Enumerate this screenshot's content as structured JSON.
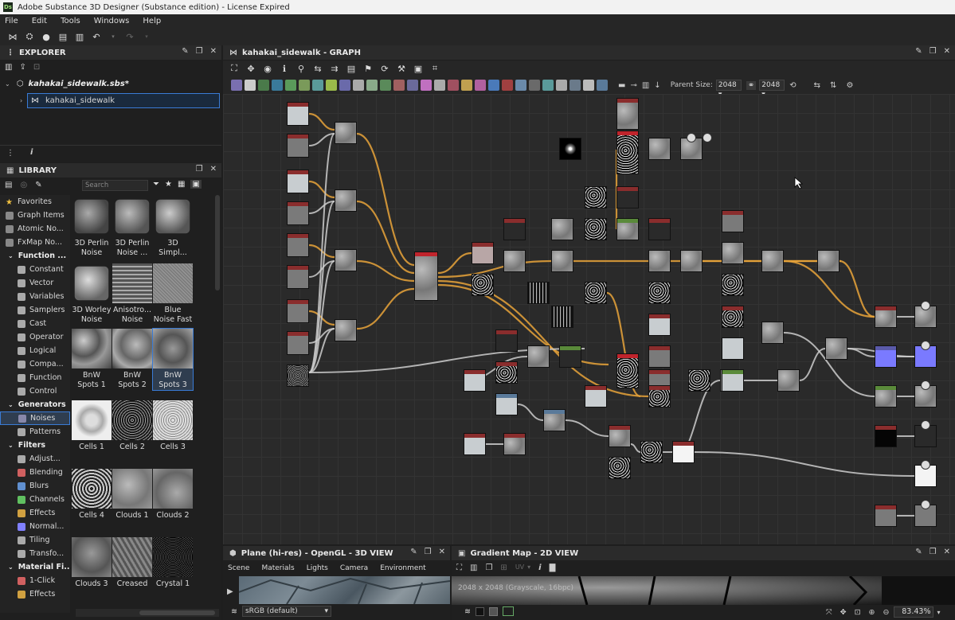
{
  "app": {
    "window_title": "Adobe Substance 3D Designer (Substance edition) - License Expired",
    "app_icon_label": "Ds"
  },
  "menu": [
    "File",
    "Edit",
    "Tools",
    "Windows",
    "Help"
  ],
  "explorer": {
    "title": "EXPLORER",
    "package": "kahakai_sidewalk.sbs*",
    "graph": "kahakai_sidewalk"
  },
  "library": {
    "title": "LIBRARY",
    "search_placeholder": "Search",
    "sidebar": [
      {
        "label": "Favorites",
        "color": "#f0c040",
        "cat": false
      },
      {
        "label": "Graph Items",
        "color": "#888888",
        "cat": false
      },
      {
        "label": "Atomic No...",
        "color": "#888888",
        "cat": false
      },
      {
        "label": "FxMap No...",
        "color": "#888888",
        "cat": false
      },
      {
        "label": "Function ...",
        "color": "",
        "cat": true
      },
      {
        "label": "Constant",
        "color": "#aaaaaa",
        "cat": false
      },
      {
        "label": "Vector",
        "color": "#aaaaaa",
        "cat": false
      },
      {
        "label": "Variables",
        "color": "#aaaaaa",
        "cat": false
      },
      {
        "label": "Samplers",
        "color": "#aaaaaa",
        "cat": false
      },
      {
        "label": "Cast",
        "color": "#aaaaaa",
        "cat": false
      },
      {
        "label": "Operator",
        "color": "#aaaaaa",
        "cat": false
      },
      {
        "label": "Logical",
        "color": "#aaaaaa",
        "cat": false
      },
      {
        "label": "Compa...",
        "color": "#aaaaaa",
        "cat": false
      },
      {
        "label": "Function",
        "color": "#aaaaaa",
        "cat": false
      },
      {
        "label": "Control",
        "color": "#aaaaaa",
        "cat": false
      },
      {
        "label": "Generators",
        "color": "",
        "cat": true
      },
      {
        "label": "Noises",
        "color": "#8888aa",
        "cat": false
      },
      {
        "label": "Patterns",
        "color": "#aaaaaa",
        "cat": false
      },
      {
        "label": "Filters",
        "color": "",
        "cat": true
      },
      {
        "label": "Adjust...",
        "color": "#aaaaaa",
        "cat": false
      },
      {
        "label": "Blending",
        "color": "#d06060",
        "cat": false
      },
      {
        "label": "Blurs",
        "color": "#6090d0",
        "cat": false
      },
      {
        "label": "Channels",
        "color": "#60c060",
        "cat": false
      },
      {
        "label": "Effects",
        "color": "#d0a040",
        "cat": false
      },
      {
        "label": "Normal...",
        "color": "#8080ff",
        "cat": false
      },
      {
        "label": "Tiling",
        "color": "#aaaaaa",
        "cat": false
      },
      {
        "label": "Transfo...",
        "color": "#aaaaaa",
        "cat": false
      },
      {
        "label": "Material Fi...",
        "color": "",
        "cat": true
      },
      {
        "label": "1-Click",
        "color": "#d06060",
        "cat": false
      },
      {
        "label": "Effects",
        "color": "#d0a040",
        "cat": false
      }
    ],
    "thumbs": [
      {
        "label": "3D Perlin Noise"
      },
      {
        "label": "3D Perlin Noise ..."
      },
      {
        "label": "3D Simpl..."
      },
      {
        "label": "3D Worley Noise"
      },
      {
        "label": "Anisotro... Noise"
      },
      {
        "label": "Blue Noise Fast"
      },
      {
        "label": "BnW Spots 1"
      },
      {
        "label": "BnW Spots 2"
      },
      {
        "label": "BnW Spots 3"
      },
      {
        "label": "Cells 1"
      },
      {
        "label": "Cells 2"
      },
      {
        "label": "Cells 3"
      },
      {
        "label": "Cells 4"
      },
      {
        "label": "Clouds 1"
      },
      {
        "label": "Clouds 2"
      },
      {
        "label": "Clouds 3"
      },
      {
        "label": "Creased"
      },
      {
        "label": "Crystal 1"
      }
    ]
  },
  "graph": {
    "title": "kahakai_sidewalk - GRAPH",
    "parent_size_label": "Parent Size:",
    "width_value": "2048",
    "height_value": "2048"
  },
  "view3d": {
    "title": "Plane (hi-res) - OpenGL - 3D VIEW",
    "tabs": [
      "Scene",
      "Materials",
      "Lights",
      "Camera",
      "Environment"
    ],
    "colorspace": "sRGB (default)"
  },
  "view2d": {
    "title": "Gradient Map - 2D VIEW",
    "info": "2048 x 2048 (Grayscale, 16bpc)",
    "uv_label": "UV",
    "zoom": "83.43%"
  }
}
